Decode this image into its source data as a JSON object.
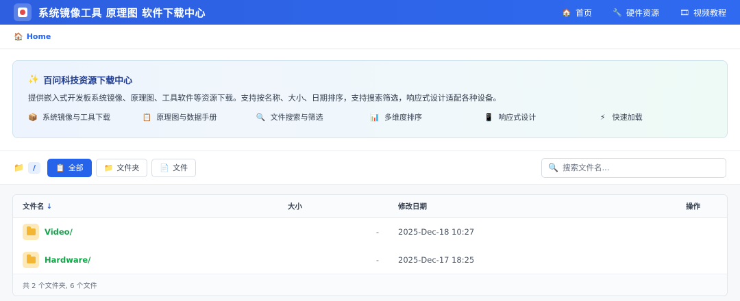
{
  "header": {
    "title": "系统镜像工具 原理图 软件下载中心",
    "nav": [
      {
        "icon": "house-icon",
        "label": "首页"
      },
      {
        "icon": "wrench-icon",
        "label": "硬件资源"
      },
      {
        "icon": "film-icon",
        "label": "视频教程"
      }
    ]
  },
  "breadcrumb": {
    "label": "Home"
  },
  "intro": {
    "title": "百问科技资源下载中心",
    "description": "提供嵌入式开发板系统镜像、原理图、工具软件等资源下载。支持按名称、大小、日期排序，支持搜索筛选，响应式设计适配各种设备。",
    "features": [
      {
        "icon": "package-icon",
        "label": "系统镜像与工具下载"
      },
      {
        "icon": "clipboard-icon",
        "label": "原理图与数据手册"
      },
      {
        "icon": "magnifier-icon",
        "label": "文件搜索与筛选"
      },
      {
        "icon": "bar-chart-icon",
        "label": "多维度排序"
      },
      {
        "icon": "phone-icon",
        "label": "响应式设计"
      },
      {
        "icon": "lightning-icon",
        "label": "快速加载"
      }
    ]
  },
  "toolbar": {
    "path": "/",
    "filters": [
      {
        "label": "全部",
        "active": true
      },
      {
        "label": "文件夹",
        "active": false
      },
      {
        "label": "文件",
        "active": false
      }
    ],
    "search_placeholder": "搜索文件名..."
  },
  "table": {
    "columns": {
      "name": "文件名",
      "sort": "↓",
      "size": "大小",
      "date": "修改日期",
      "actions": "操作"
    },
    "rows": [
      {
        "name": "Video/",
        "size": "-",
        "date": "2025-Dec-18 10:27"
      },
      {
        "name": "Hardware/",
        "size": "-",
        "date": "2025-Dec-17 18:25"
      }
    ],
    "footer": "共 2 个文件夹, 6 个文件"
  },
  "colors": {
    "primary": "#2563eb",
    "folder_name": "#16a34a",
    "folder_icon": "#f2b634"
  }
}
